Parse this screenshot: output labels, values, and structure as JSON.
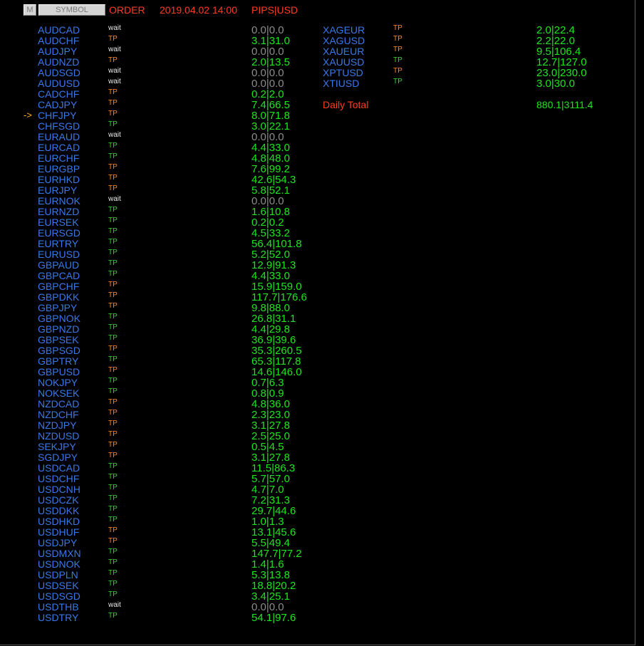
{
  "header": {
    "m_button": "M",
    "symbol_button": "SYMBOL",
    "order_label": "ORDER",
    "datetime": "2019.04.02 14:00",
    "units": "PIPS|USD"
  },
  "selected_arrow": "->",
  "selected_index": 8,
  "left_rows": [
    {
      "symbol": "AUDCAD",
      "status": "wait",
      "value": "0.0|0.0"
    },
    {
      "symbol": "AUDCHF",
      "status": "TP",
      "value": "3.1|31.0"
    },
    {
      "symbol": "AUDJPY",
      "status": "wait",
      "value": "0.0|0.0"
    },
    {
      "symbol": "AUDNZD",
      "status": "TP",
      "value": "2.0|13.5"
    },
    {
      "symbol": "AUDSGD",
      "status": "wait",
      "value": "0.0|0.0"
    },
    {
      "symbol": "AUDUSD",
      "status": "wait",
      "value": "0.0|0.0"
    },
    {
      "symbol": "CADCHF",
      "status": "TP",
      "value": "0.2|2.0"
    },
    {
      "symbol": "CADJPY",
      "status": "TP",
      "value": "7.4|66.5"
    },
    {
      "symbol": "CHFJPY",
      "status": "TP",
      "value": "8.0|71.8"
    },
    {
      "symbol": "CHFSGD",
      "status": "TP",
      "value": "3.0|22.1"
    },
    {
      "symbol": "EURAUD",
      "status": "wait",
      "value": "0.0|0.0"
    },
    {
      "symbol": "EURCAD",
      "status": "TP",
      "value": "4.4|33.0"
    },
    {
      "symbol": "EURCHF",
      "status": "TP",
      "value": "4.8|48.0"
    },
    {
      "symbol": "EURGBP",
      "status": "TP",
      "value": "7.6|99.2"
    },
    {
      "symbol": "EURHKD",
      "status": "TP",
      "value": "42.6|54.3"
    },
    {
      "symbol": "EURJPY",
      "status": "TP",
      "value": "5.8|52.1"
    },
    {
      "symbol": "EURNOK",
      "status": "wait",
      "value": "0.0|0.0"
    },
    {
      "symbol": "EURNZD",
      "status": "TP",
      "value": "1.6|10.8"
    },
    {
      "symbol": "EURSEK",
      "status": "TP",
      "value": "0.2|0.2"
    },
    {
      "symbol": "EURSGD",
      "status": "TP",
      "value": "4.5|33.2"
    },
    {
      "symbol": "EURTRY",
      "status": "TP",
      "value": "56.4|101.8"
    },
    {
      "symbol": "EURUSD",
      "status": "TP",
      "value": "5.2|52.0"
    },
    {
      "symbol": "GBPAUD",
      "status": "TP",
      "value": "12.9|91.3"
    },
    {
      "symbol": "GBPCAD",
      "status": "TP",
      "value": "4.4|33.0"
    },
    {
      "symbol": "GBPCHF",
      "status": "TP",
      "value": "15.9|159.0"
    },
    {
      "symbol": "GBPDKK",
      "status": "TP",
      "value": "117.7|176.6"
    },
    {
      "symbol": "GBPJPY",
      "status": "TP",
      "value": "9.8|88.0"
    },
    {
      "symbol": "GBPNOK",
      "status": "TP",
      "value": "26.8|31.1"
    },
    {
      "symbol": "GBPNZD",
      "status": "TP",
      "value": "4.4|29.8"
    },
    {
      "symbol": "GBPSEK",
      "status": "TP",
      "value": "36.9|39.6"
    },
    {
      "symbol": "GBPSGD",
      "status": "TP",
      "value": "35.3|260.5"
    },
    {
      "symbol": "GBPTRY",
      "status": "TP",
      "value": "65.3|117.8"
    },
    {
      "symbol": "GBPUSD",
      "status": "TP",
      "value": "14.6|146.0"
    },
    {
      "symbol": "NOKJPY",
      "status": "TP",
      "value": "0.7|6.3"
    },
    {
      "symbol": "NOKSEK",
      "status": "TP",
      "value": "0.8|0.9"
    },
    {
      "symbol": "NZDCAD",
      "status": "TP",
      "value": "4.8|36.0"
    },
    {
      "symbol": "NZDCHF",
      "status": "TP",
      "value": "2.3|23.0"
    },
    {
      "symbol": "NZDJPY",
      "status": "TP",
      "value": "3.1|27.8"
    },
    {
      "symbol": "NZDUSD",
      "status": "TP",
      "value": "2.5|25.0"
    },
    {
      "symbol": "SEKJPY",
      "status": "TP",
      "value": "0.5|4.5"
    },
    {
      "symbol": "SGDJPY",
      "status": "TP",
      "value": "3.1|27.8"
    },
    {
      "symbol": "USDCAD",
      "status": "TP",
      "value": "11.5|86.3"
    },
    {
      "symbol": "USDCHF",
      "status": "TP",
      "value": "5.7|57.0"
    },
    {
      "symbol": "USDCNH",
      "status": "TP",
      "value": "4.7|7.0"
    },
    {
      "symbol": "USDCZK",
      "status": "TP",
      "value": "7.2|31.3"
    },
    {
      "symbol": "USDDKK",
      "status": "TP",
      "value": "29.7|44.6"
    },
    {
      "symbol": "USDHKD",
      "status": "TP",
      "value": "1.0|1.3"
    },
    {
      "symbol": "USDHUF",
      "status": "TP",
      "value": "13.1|45.6"
    },
    {
      "symbol": "USDJPY",
      "status": "TP",
      "value": "5.5|49.4"
    },
    {
      "symbol": "USDMXN",
      "status": "TP",
      "value": "147.7|77.2"
    },
    {
      "symbol": "USDNOK",
      "status": "TP",
      "value": "1.4|1.6"
    },
    {
      "symbol": "USDPLN",
      "status": "TP",
      "value": "5.3|13.8"
    },
    {
      "symbol": "USDSEK",
      "status": "TP",
      "value": "18.8|20.2"
    },
    {
      "symbol": "USDSGD",
      "status": "TP",
      "value": "3.4|25.1"
    },
    {
      "symbol": "USDTHB",
      "status": "wait",
      "value": "0.0|0.0"
    },
    {
      "symbol": "USDTRY",
      "status": "TP",
      "value": "54.1|97.6"
    }
  ],
  "right_rows": [
    {
      "symbol": "XAGEUR",
      "status": "TP",
      "value": "2.0|22.4"
    },
    {
      "symbol": "XAGUSD",
      "status": "TP",
      "value": "2.2|22.0"
    },
    {
      "symbol": "XAUEUR",
      "status": "TP",
      "value": "9.5|106.4"
    },
    {
      "symbol": "XAUUSD",
      "status": "TP",
      "value": "12.7|127.0"
    },
    {
      "symbol": "XPTUSD",
      "status": "TP",
      "value": "23.0|230.0"
    },
    {
      "symbol": "XTIUSD",
      "status": "TP",
      "value": "3.0|30.0"
    }
  ],
  "daily_total": {
    "label": "Daily Total",
    "value": "880.1|3111.4"
  },
  "colors": {
    "symbol": "#3a78e8",
    "header_text": "#ff3b22",
    "value_positive": "#1ee61e",
    "value_zero": "#8c8c8c",
    "status_wait": "#e8e8e8",
    "status_tp_orange": "#ff8a1c",
    "status_tp_green": "#3ad33a"
  }
}
